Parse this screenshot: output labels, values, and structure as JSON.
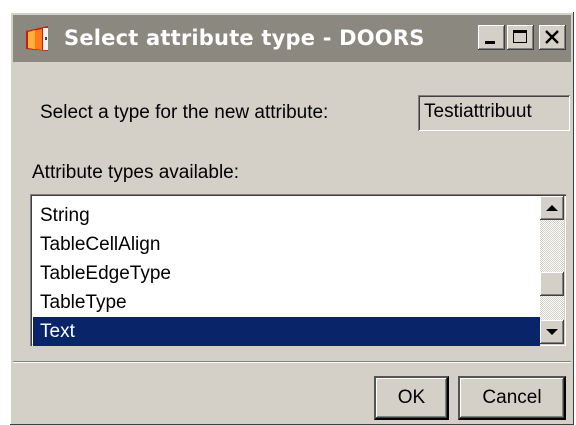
{
  "window": {
    "title": "Select attribute type - DOORS",
    "app_icon": "doors-app-icon",
    "controls": {
      "minimize_icon": "minimize-icon",
      "maximize_icon": "maximize-icon",
      "close_icon": "close-icon"
    }
  },
  "form": {
    "prompt_label": "Select a type for the new attribute:",
    "attribute_name_value": "Testiattribuut",
    "types_label": "Attribute types available:"
  },
  "attribute_types": {
    "items": [
      "String",
      "TableCellAlign",
      "TableEdgeType",
      "TableType",
      "Text"
    ],
    "selected": "Text",
    "scroll_up_icon": "arrow-up-icon",
    "scroll_down_icon": "arrow-down-icon"
  },
  "buttons": {
    "ok_label": "OK",
    "cancel_label": "Cancel"
  },
  "colors": {
    "titlebar_inactive": "#8a887f",
    "dialog_face": "#d4d0c8",
    "selection": "#0a246a",
    "app_icon_accent": "#e8400c"
  }
}
